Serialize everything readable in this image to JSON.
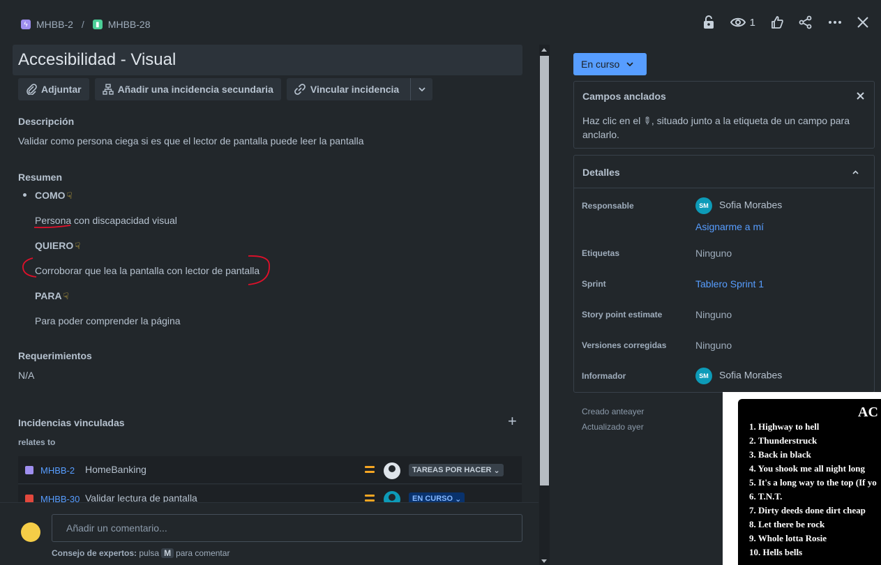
{
  "breadcrumb": {
    "parent_key": "MHBB-2",
    "separator": "/",
    "issue_key": "MHBB-28"
  },
  "toolbar": {
    "watchers_count": "1"
  },
  "issue": {
    "title": "Accesibilidad - Visual"
  },
  "buttons": {
    "attach": "Adjuntar",
    "add_child": "Añadir una incidencia secundaria",
    "link_issue": "Vincular incidencia"
  },
  "description": {
    "heading": "Descripción",
    "text": "Validar como persona ciega si es que el lector de pantalla puede leer la pantalla"
  },
  "summary": {
    "heading": "Resumen",
    "como_label": "COMO",
    "como_text": "Persona con discapacidad visual",
    "quiero_label": "QUIERO",
    "quiero_text": "Corroborar que lea la pantalla con lector de pantalla",
    "para_label": "PARA",
    "para_text": "Para poder comprender la página"
  },
  "requirements": {
    "heading": "Requerimientos",
    "text": "N/A"
  },
  "linked_issues": {
    "heading": "Incidencias vinculadas",
    "relation": "relates to",
    "items": [
      {
        "key": "MHBB-2",
        "summary": "HomeBanking",
        "status": "TAREAS POR HACER"
      },
      {
        "key": "MHBB-30",
        "summary": "Validar lectura de pantalla",
        "status": "EN CURSO"
      }
    ]
  },
  "comment": {
    "placeholder": "Añadir un comentario...",
    "tip_bold": "Consejo de expertos:",
    "tip_press": "pulsa",
    "tip_key": "M",
    "tip_rest": "para comentar"
  },
  "status_button": {
    "label": "En curso"
  },
  "pinned": {
    "heading": "Campos anclados",
    "text_before": "Haz clic en el",
    "text_after": ", situado junto a la etiqueta de un campo para anclarlo."
  },
  "details": {
    "heading": "Detalles",
    "assignee_label": "Responsable",
    "assignee_initials": "SM",
    "assignee_name": "Sofia Morabes",
    "assign_me": "Asignarme a mí",
    "labels_label": "Etiquetas",
    "labels_value": "Ninguno",
    "sprint_label": "Sprint",
    "sprint_value": "Tablero Sprint 1",
    "story_points_label": "Story point estimate",
    "story_points_value": "Ninguno",
    "fix_versions_label": "Versiones corregidas",
    "fix_versions_value": "Ninguno",
    "reporter_label": "Informador",
    "reporter_initials": "SM",
    "reporter_name": "Sofia Morabes"
  },
  "meta": {
    "created": "Creado anteayer",
    "updated": "Actualizado ayer"
  },
  "poster": {
    "title": "AC",
    "songs": [
      "1. Highway to hell",
      "2. Thunderstruck",
      "3. Back in black",
      "4. You shook me all night long",
      "5. It's a long way to the top (If yo",
      "6. T.N.T.",
      "7. Dirty deeds done dirt cheap",
      "8. Let there be rock",
      "9. Whole lotta Rosie",
      "10. Hells bells"
    ]
  }
}
